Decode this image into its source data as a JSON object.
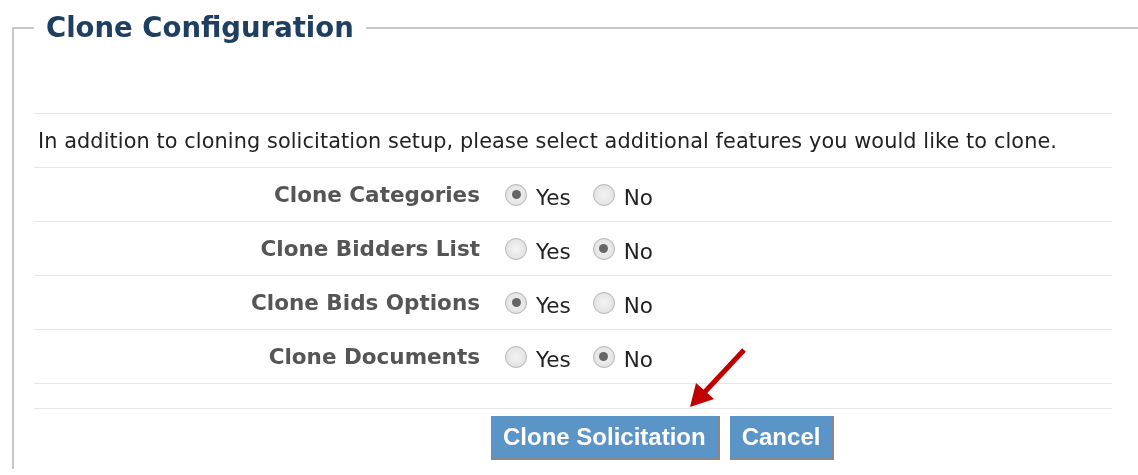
{
  "title": "Clone Configuration",
  "intro": "In addition to cloning solicitation setup, please select additional features you would like to clone.",
  "options": [
    {
      "label": "Clone Categories",
      "choices": [
        {
          "label": "Yes",
          "selected": true
        },
        {
          "label": "No",
          "selected": false
        }
      ]
    },
    {
      "label": "Clone Bidders List",
      "choices": [
        {
          "label": "Yes",
          "selected": false
        },
        {
          "label": "No",
          "selected": true
        }
      ]
    },
    {
      "label": "Clone Bids Options",
      "choices": [
        {
          "label": "Yes",
          "selected": true
        },
        {
          "label": "No",
          "selected": false
        }
      ]
    },
    {
      "label": "Clone Documents",
      "choices": [
        {
          "label": "Yes",
          "selected": false
        },
        {
          "label": "No",
          "selected": true
        }
      ]
    }
  ],
  "buttons": [
    {
      "label": "Clone Solicitation"
    },
    {
      "label": "Cancel"
    }
  ]
}
